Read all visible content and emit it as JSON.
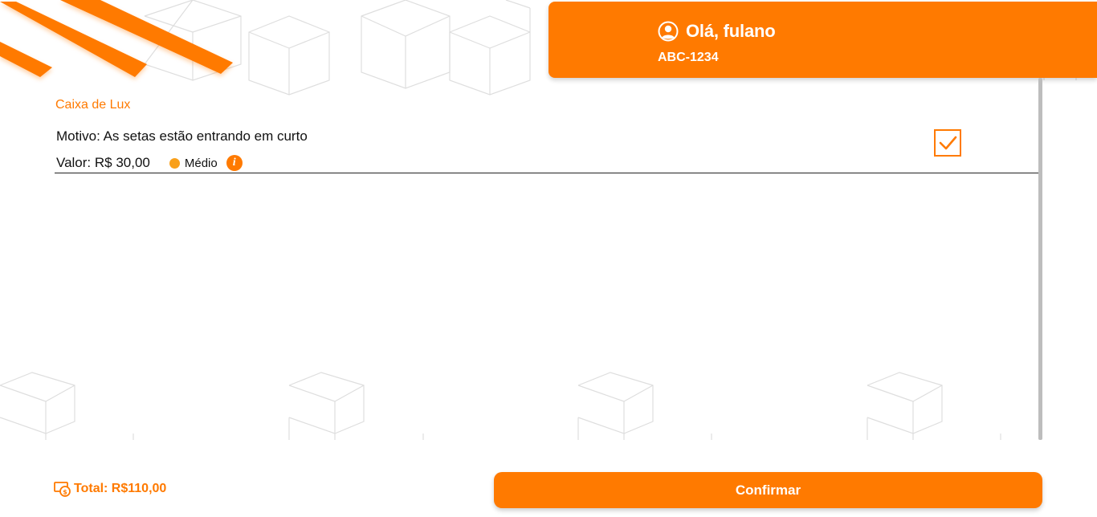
{
  "header": {
    "greeting": "Olá, fulano",
    "plate": "ABC-1234",
    "user_icon": "user-circle-icon"
  },
  "item": {
    "title": "Caixa de Lux",
    "reason": "Motivo: As setas estão entrando em curto",
    "value": "Valor: R$ 30,00",
    "priority": "Médio",
    "priority_color": "#f9a01b",
    "checked": true
  },
  "footer": {
    "total": "Total: R$110,00",
    "confirm_label": "Confirmar"
  },
  "colors": {
    "accent": "#ff7a00",
    "pattern": "#dcdcdc"
  }
}
